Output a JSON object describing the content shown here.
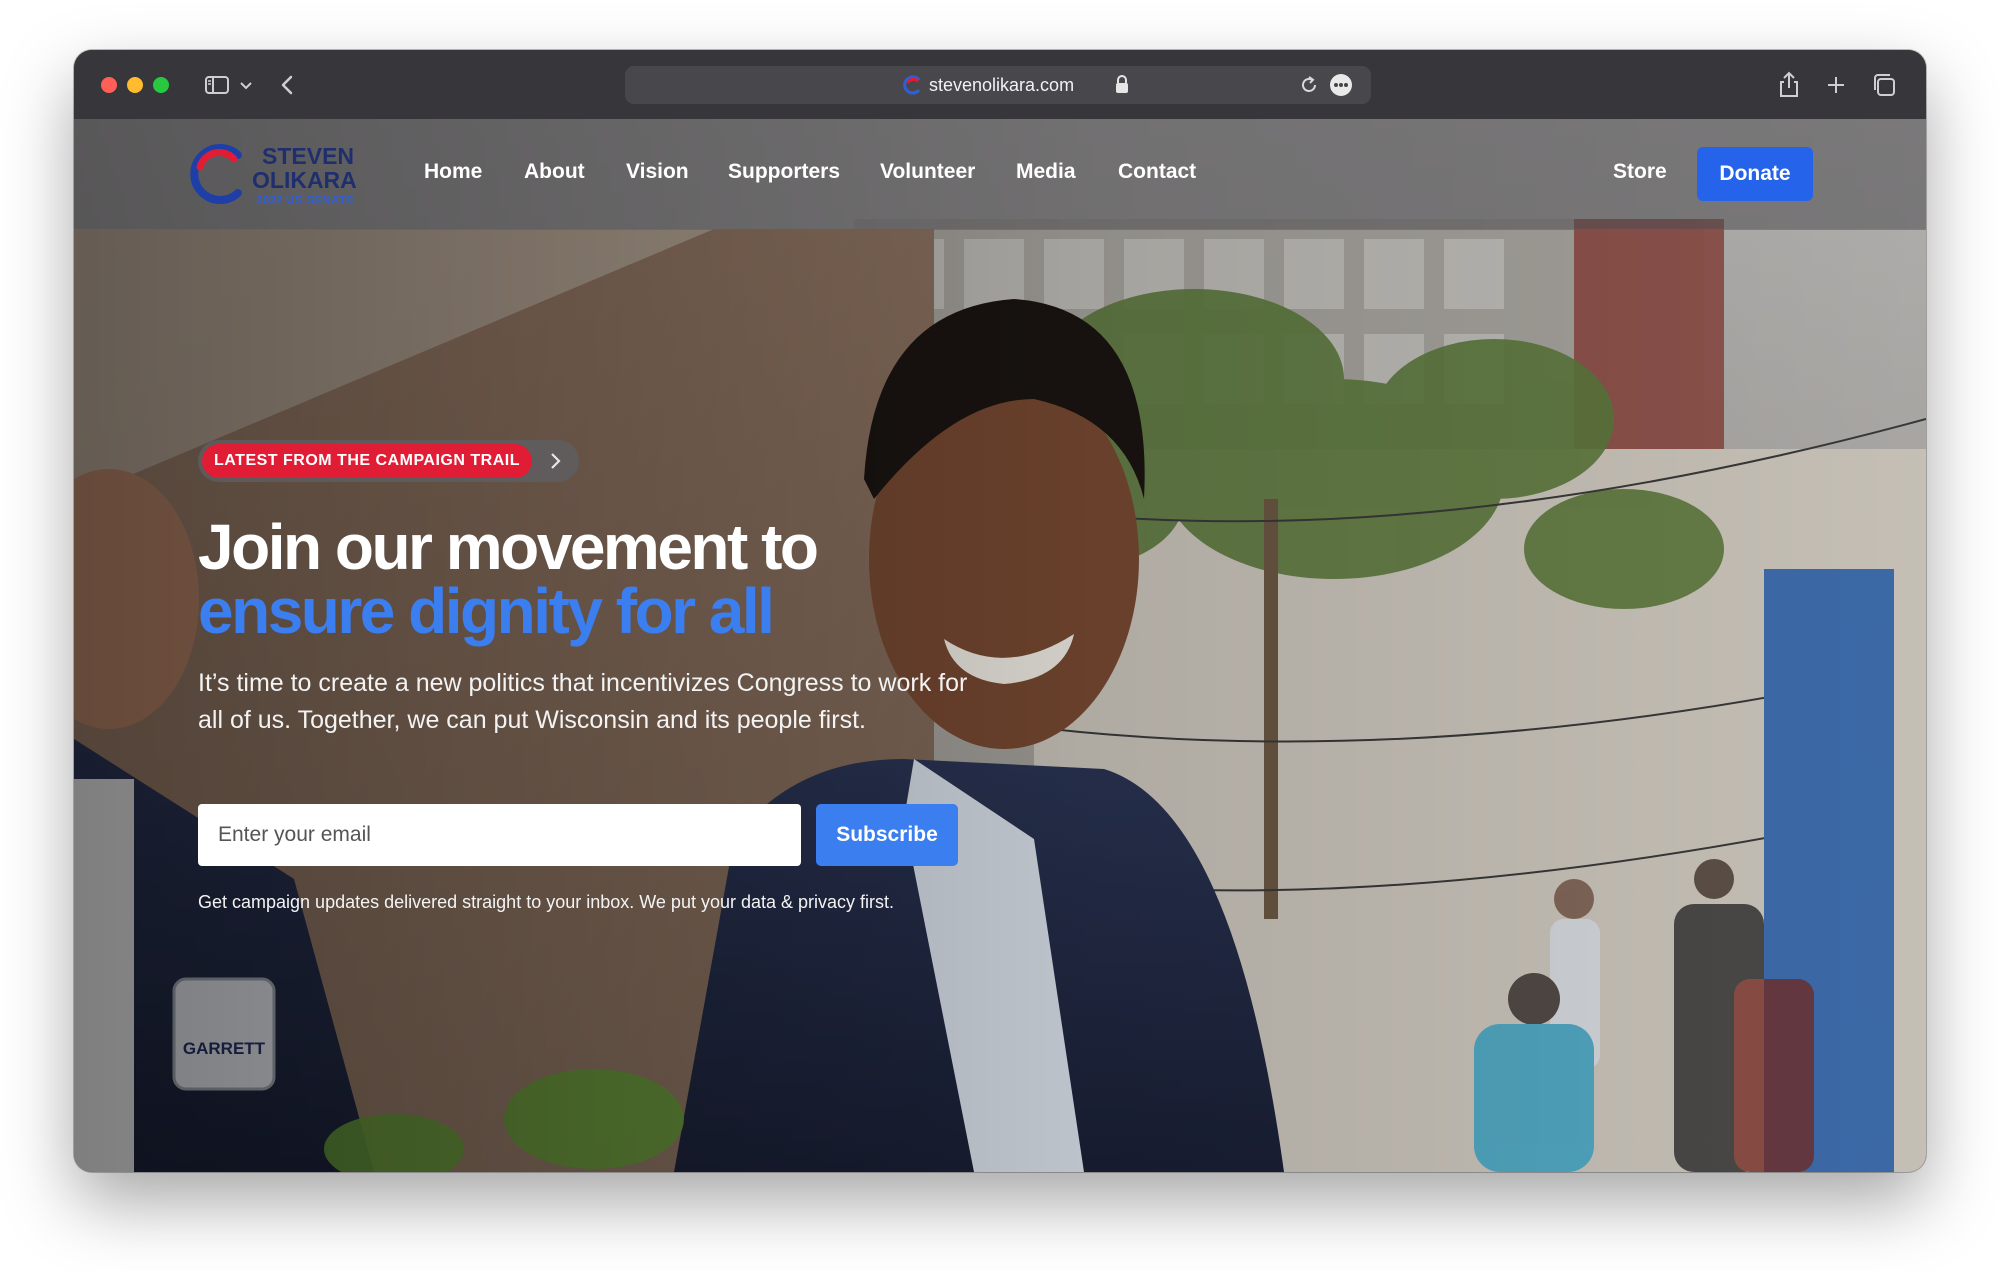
{
  "browser": {
    "url": "stevenolikara.com",
    "icons": [
      "sidebar-icon",
      "chevron-down-icon",
      "back-arrow-icon",
      "lock-icon",
      "reload-icon",
      "more-icon",
      "share-icon",
      "new-tab-icon",
      "tab-overview-icon"
    ]
  },
  "logo": {
    "line1": "STEVEN",
    "line2": "OLIKARA",
    "line3": "2022 US SENATE"
  },
  "nav": {
    "items": [
      "Home",
      "About",
      "Vision",
      "Supporters",
      "Volunteer",
      "Media",
      "Contact"
    ],
    "store": "Store",
    "donate": "Donate"
  },
  "hero": {
    "badge": "LATEST FROM THE CAMPAIGN TRAIL",
    "headline_line1": "Join our movement to",
    "headline_line2": "ensure dignity for all",
    "subtext": "It’s time to create a new politics that incentivizes Congress to work for all of us. Together, we can put Wisconsin and its people first.",
    "email_placeholder": "Enter your email",
    "subscribe": "Subscribe",
    "fine_print": "Get campaign updates delivered straight to your inbox. We put your data & privacy first."
  },
  "colors": {
    "accent_blue": "#3b7ef0",
    "donate_blue": "#2563eb",
    "badge_red": "#e11d35",
    "logo_navy": "#1f2f6e"
  }
}
